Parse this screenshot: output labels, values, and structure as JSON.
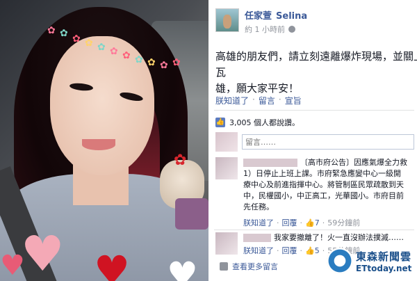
{
  "post": {
    "author_name": "任家萱",
    "author_name_en": "Selina",
    "timestamp": "約 1 小時前",
    "body": "高雄的朋友們，請立刻遠離爆炸現場，並關上瓦\n雄，願大家平安！",
    "actions": [
      "朕知道了",
      "留言",
      "宣旨"
    ],
    "likes_text": "3,005 個人都說讚。",
    "comment_placeholder": "留言……"
  },
  "comments": [
    {
      "text": "〔高市府公告〕因應氣爆全力救\n1）日停止上班上課。市府緊急應變中心一級開\n療中心及前進指揮中心。將管制區民眾疏散到天\n中，民權國小，中正高工，光華國小。市府目前\n先任務。",
      "actions": [
        "朕知道了",
        "回覆"
      ],
      "likes": "7",
      "time": "59分鐘前"
    },
    {
      "text": "我家要撤離了！火一直沒辦法撲滅……",
      "actions": [
        "朕知道了",
        "回覆"
      ],
      "likes": "5",
      "time": "55分鐘前"
    }
  ],
  "see_more": "查看更多留言",
  "watermark": {
    "cn": "東森新聞雲",
    "en": "ETtoday.net"
  },
  "colors": {
    "link": "#3b5998",
    "muted": "#90949c",
    "text": "#141823"
  }
}
